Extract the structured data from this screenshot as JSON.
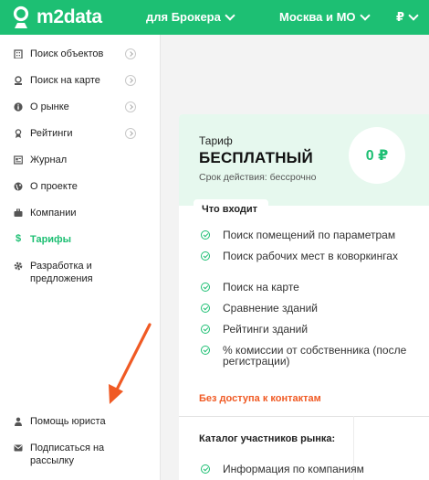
{
  "header": {
    "logo_text": "m2data",
    "broker_label": "для Брокера",
    "city_label": "Москва и МО",
    "currency_label": "₽"
  },
  "sidebar": {
    "items": [
      {
        "label": "Поиск объектов",
        "icon": "building-icon",
        "arrow": true
      },
      {
        "label": "Поиск на карте",
        "icon": "map-pin-icon",
        "arrow": true
      },
      {
        "label": "О рынке",
        "icon": "info-icon",
        "arrow": true
      },
      {
        "label": "Рейтинги",
        "icon": "award-icon",
        "arrow": true
      },
      {
        "label": "Журнал",
        "icon": "journal-icon",
        "arrow": false
      },
      {
        "label": "О проекте",
        "icon": "globe-icon",
        "arrow": false
      },
      {
        "label": "Компании",
        "icon": "briefcase-icon",
        "arrow": false
      },
      {
        "label": "Тарифы",
        "icon": "dollar-icon",
        "arrow": false,
        "active": true
      },
      {
        "label": "Разработка и предложения",
        "icon": "gear-icon",
        "arrow": false
      }
    ],
    "bottom_items": [
      {
        "label": "Помощь юриста",
        "icon": "lawyer-icon"
      },
      {
        "label": "Подписаться на рассылку",
        "icon": "mail-icon"
      }
    ]
  },
  "tariff": {
    "label": "Тариф",
    "name": "БЕСПЛАТНЫЙ",
    "term": "Срок действия: бессрочно",
    "price": "0 ₽",
    "includes_title": "Что входит",
    "features": [
      "Поиск помещений по параметрам",
      "Поиск рабочих мест в коворкингах",
      "Поиск на карте",
      "Сравнение зданий",
      "Рейтинги зданий",
      "% комиссии от собственника (после регистрации)"
    ],
    "no_access": "Без доступа к контактам",
    "catalog_title": "Каталог участников рынка:",
    "catalog_features": [
      "Информация по компаниям"
    ]
  },
  "colors": {
    "brand": "#1dbf73",
    "accent_orange": "#f05a24"
  }
}
